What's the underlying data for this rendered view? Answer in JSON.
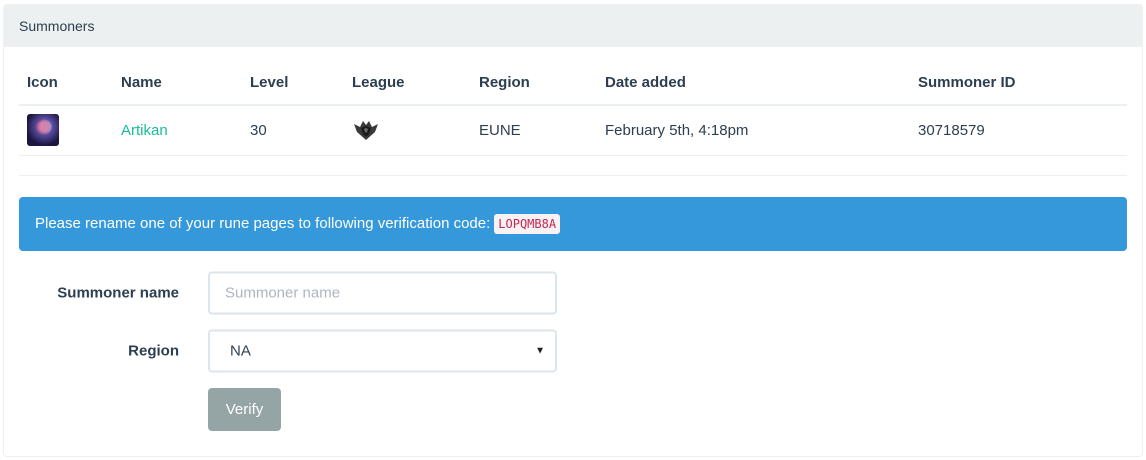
{
  "panel": {
    "title": "Summoners"
  },
  "table": {
    "headers": [
      "Icon",
      "Name",
      "Level",
      "League",
      "Region",
      "Date added",
      "Summoner ID"
    ],
    "rows": [
      {
        "icon": "summoner-avatar",
        "name": "Artikan",
        "level": "30",
        "league": "league-emblem-icon",
        "region": "EUNE",
        "date_added": "February 5th, 4:18pm",
        "summoner_id": "30718579"
      }
    ]
  },
  "alert": {
    "message": "Please rename one of your rune pages to following verification code:",
    "code": "LOPQMB8A"
  },
  "form": {
    "summoner_name_label": "Summoner name",
    "summoner_name_placeholder": "Summoner name",
    "summoner_name_value": "",
    "region_label": "Region",
    "region_value": "NA",
    "verify_label": "Verify"
  },
  "colors": {
    "link": "#18bc9c",
    "alert_bg": "#3498db",
    "button_bg": "#95a5a6",
    "heading_bg": "#ecf0f1"
  }
}
